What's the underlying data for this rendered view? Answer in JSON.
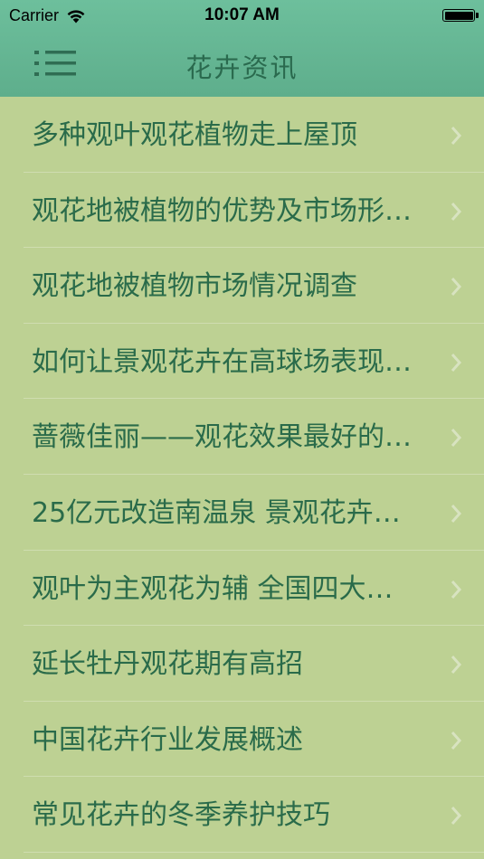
{
  "status_bar": {
    "carrier": "Carrier",
    "time": "10:07 AM",
    "icons": [
      "wifi-icon",
      "battery-icon"
    ]
  },
  "nav": {
    "title": "花卉资讯",
    "menu_icon": "list-menu-icon"
  },
  "colors": {
    "header": "#64b592",
    "background": "#bdd193",
    "title_text": "#2a6a4e",
    "item_text": "#2a6b4a",
    "chevron": "#d8e3c0"
  },
  "articles": [
    {
      "title": "多种观叶观花植物走上屋顶"
    },
    {
      "title": "观花地被植物的优势及市场形…"
    },
    {
      "title": "观花地被植物市场情况调查"
    },
    {
      "title": "如何让景观花卉在高球场表现…"
    },
    {
      "title": "蔷薇佳丽——观花效果最好的…"
    },
    {
      "title": "25亿元改造南温泉 景观花卉…"
    },
    {
      "title": "观叶为主观花为辅 全国四大…"
    },
    {
      "title": "延长牡丹观花期有高招"
    },
    {
      "title": "中国花卉行业发展概述"
    },
    {
      "title": "常见花卉的冬季养护技巧"
    }
  ]
}
